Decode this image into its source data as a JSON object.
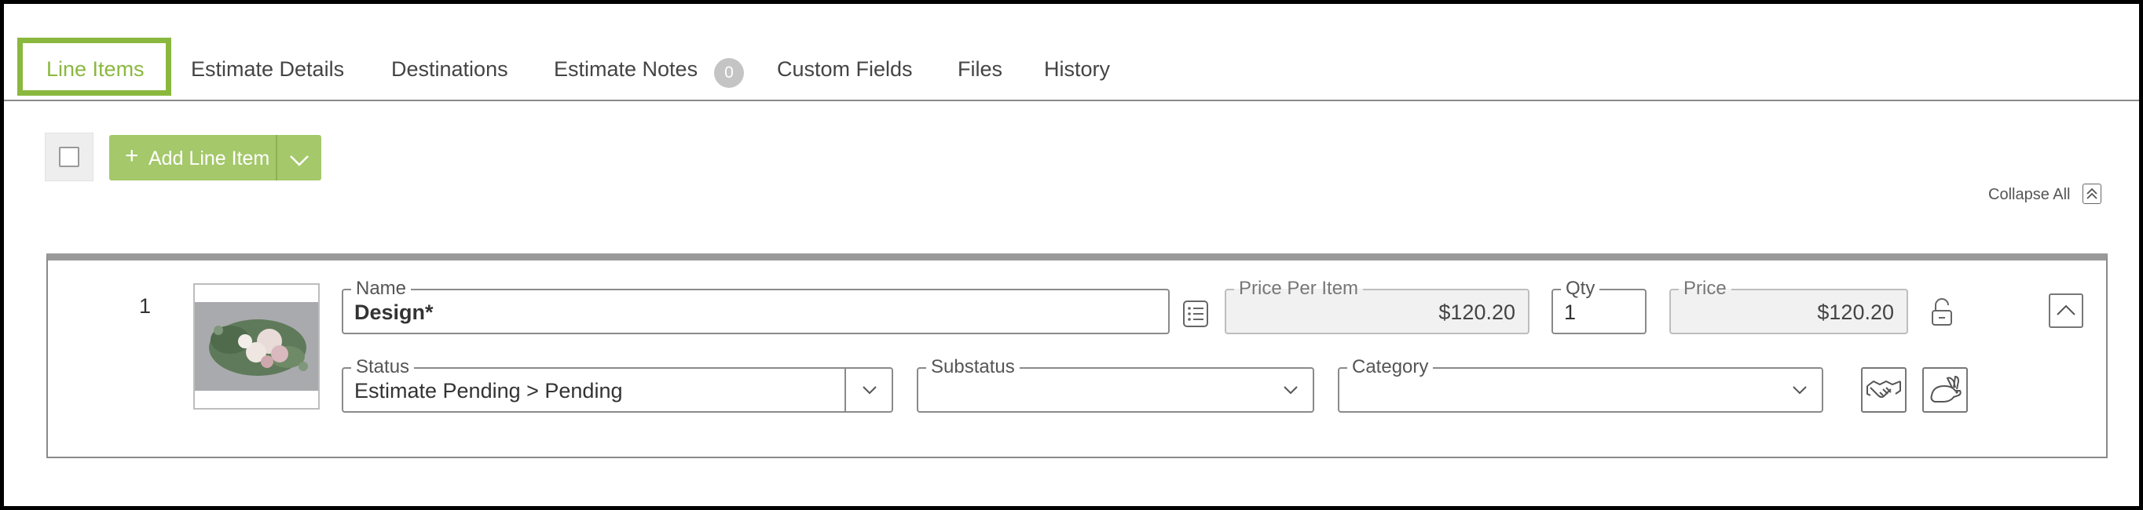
{
  "tabs": [
    {
      "label": "Line Items",
      "active": true
    },
    {
      "label": "Estimate Details"
    },
    {
      "label": "Destinations"
    },
    {
      "label": "Estimate Notes",
      "badge": "0"
    },
    {
      "label": "Custom Fields"
    },
    {
      "label": "Files"
    },
    {
      "label": "History"
    }
  ],
  "toolbar": {
    "add_label": "Add Line Item",
    "collapse_all": "Collapse All"
  },
  "colors": {
    "accent": "#8ab83f",
    "button": "#a4c86a"
  },
  "line_item": {
    "number": "1",
    "image_alt": "floral arrangement thumbnail",
    "name": {
      "label": "Name",
      "value": "Design*"
    },
    "price_per_item": {
      "label": "Price Per Item",
      "value": "$120.20"
    },
    "qty": {
      "label": "Qty",
      "value": "1"
    },
    "price": {
      "label": "Price",
      "value": "$120.20"
    },
    "status": {
      "label": "Status",
      "value": "Estimate Pending > Pending"
    },
    "substatus": {
      "label": "Substatus",
      "value": ""
    },
    "category": {
      "label": "Category",
      "value": ""
    }
  },
  "icons": {
    "details": "list-icon",
    "lock": "unlock-icon",
    "collapse": "chevron-up-icon",
    "handshake": "handshake-icon",
    "rabbit": "rabbit-icon",
    "dropdown": "chevron-down-icon"
  }
}
